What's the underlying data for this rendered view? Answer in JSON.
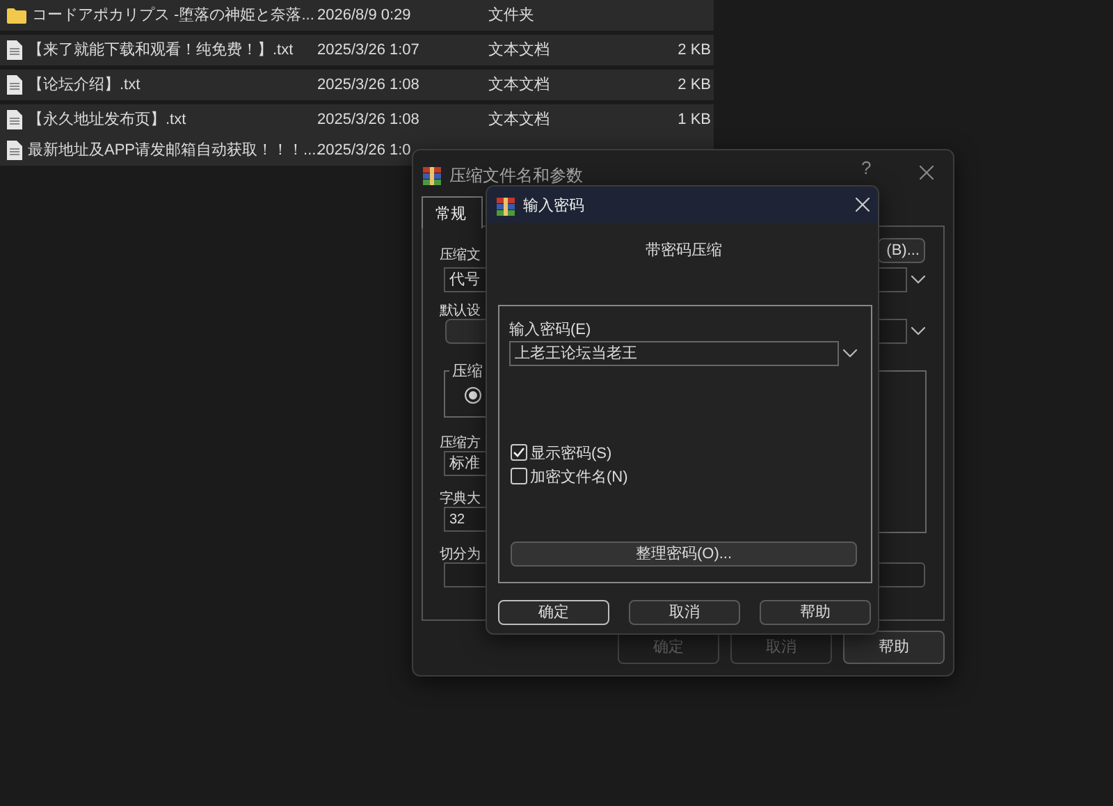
{
  "files": [
    {
      "kind": "folder",
      "name": "コードアポカリプス -堕落の神姫と奈落...",
      "modified": "2026/8/9 0:29",
      "type": "文件夹"
    },
    {
      "kind": "file",
      "name": "【来了就能下载和观看！纯免费！】.txt",
      "modified": "2025/3/26 1:07",
      "type": "文本文档",
      "size": "2 KB"
    },
    {
      "kind": "file",
      "name": "【论坛介绍】.txt",
      "modified": "2025/3/26 1:08",
      "type": "文本文档",
      "size": "2 KB"
    },
    {
      "kind": "file",
      "name": "【永久地址发布页】.txt",
      "modified": "2025/3/26 1:08",
      "type": "文本文档",
      "size": "1 KB"
    },
    {
      "kind": "file",
      "name": "最新地址及APP请发邮箱自动获取！！！....",
      "modified": "2025/3/26 1:0"
    }
  ],
  "archive_dialog": {
    "title": "压缩文件名和参数",
    "help": "?",
    "tabs": [
      {
        "label": "常规",
        "selected": true
      }
    ],
    "archive_name_label": "压缩文",
    "archive_name_value": "代号",
    "browse_button": "(B)...",
    "profile_label": "默认设",
    "format_group_label": "压缩",
    "format_radio_checked": true,
    "method_label": "压缩方",
    "method_value": "标准",
    "dictionary_label": "字典大",
    "dictionary_value": "32",
    "split_label": "切分为",
    "buttons": [
      {
        "label": "确定",
        "disabled": true
      },
      {
        "label": "取消",
        "disabled": true
      },
      {
        "label": "帮助",
        "disabled": false
      }
    ]
  },
  "password_dialog": {
    "title": "输入密码",
    "heading": "带密码压缩",
    "password_label": "输入密码(E)",
    "password_value": "上老王论坛当老王",
    "checkboxes": [
      {
        "label": "显示密码(S)",
        "checked": true
      },
      {
        "label": "加密文件名(N)",
        "checked": false
      }
    ],
    "organize_button": "整理密码(O)...",
    "buttons": [
      {
        "label": "确定",
        "default": true
      },
      {
        "label": "取消",
        "default": false
      },
      {
        "label": "帮助",
        "default": false
      }
    ]
  }
}
